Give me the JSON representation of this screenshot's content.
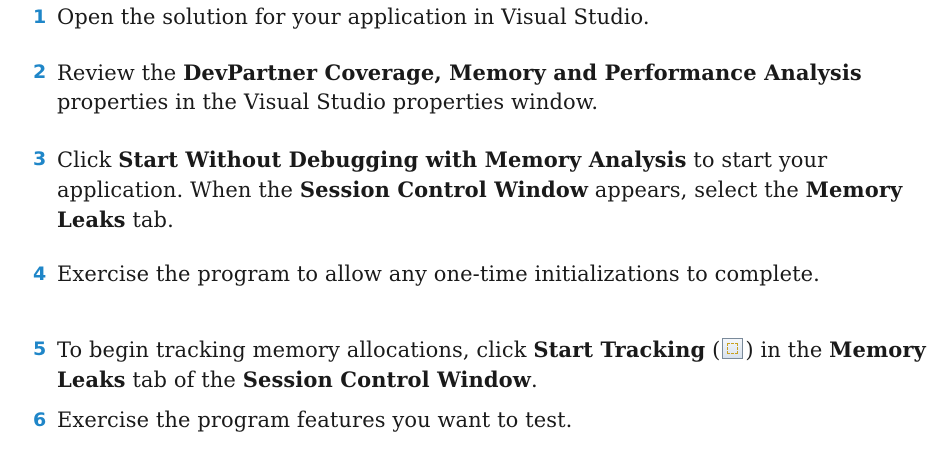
{
  "steps": [
    {
      "num": "1",
      "parts": [
        "Open the solution for your application in Visual Studio."
      ]
    },
    {
      "num": "2",
      "parts": [
        "Review the ",
        "DevPartner Coverage, Memory and Performance Analysis",
        " properties in the Visual Studio properties window."
      ]
    },
    {
      "num": "3",
      "parts": [
        "Click ",
        "Start Without Debugging with Memory Analysis",
        " to start your application. When the ",
        "Session Control Window",
        " appears, select the ",
        "Memory Leaks",
        " tab."
      ]
    },
    {
      "num": "4",
      "parts": [
        "Exercise the program to allow any one-time initializations to complete."
      ]
    },
    {
      "num": "5",
      "parts": [
        "To begin tracking memory allocations, click ",
        "Start Tracking",
        " (",
        ") in the ",
        "Memory Leaks",
        " tab of the ",
        "Session Control Window",
        "."
      ]
    },
    {
      "num": "6",
      "parts": [
        "Exercise the program features you want to test."
      ]
    }
  ],
  "icons": {
    "start_tracking": "start-tracking-icon"
  },
  "colors": {
    "step_number": "#1f86c8",
    "text": "#1a1a1a"
  }
}
